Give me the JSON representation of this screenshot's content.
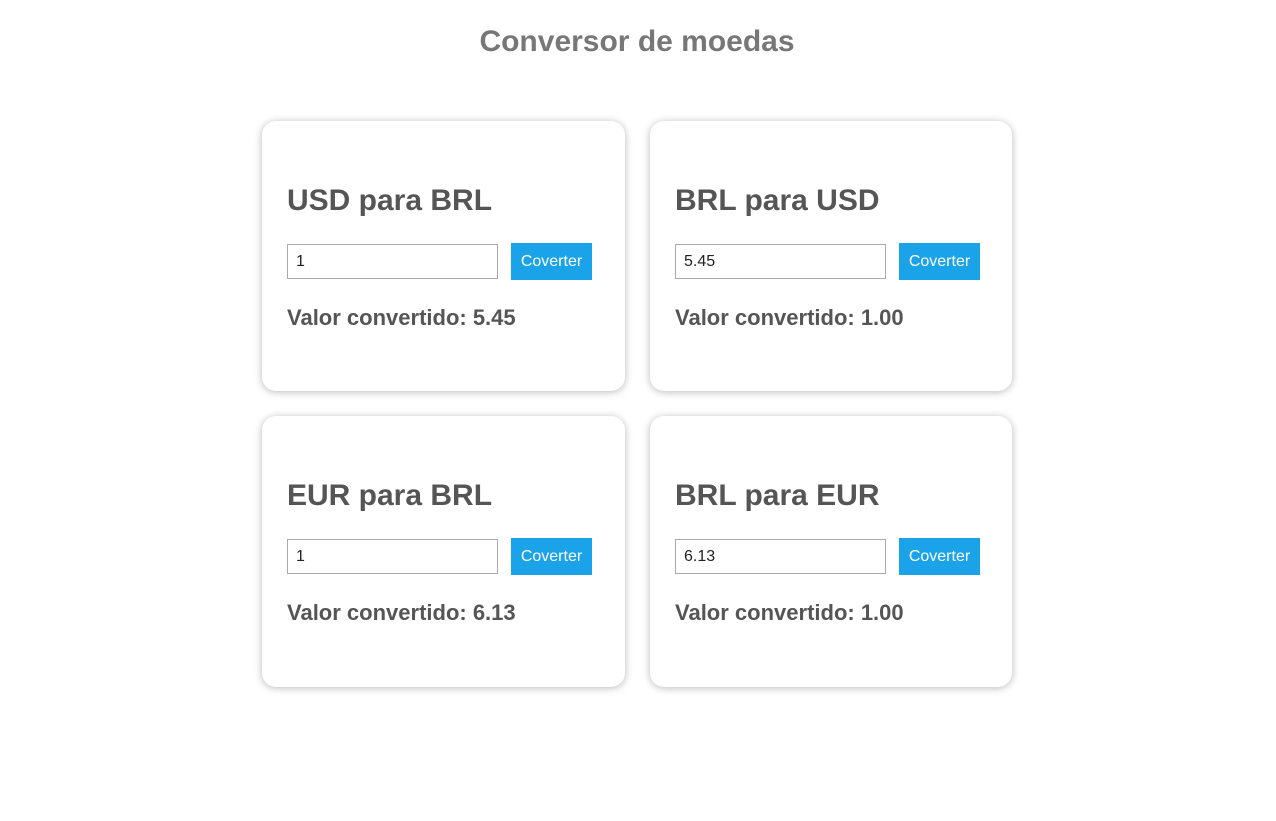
{
  "page": {
    "title": "Conversor de moedas"
  },
  "colors": {
    "button": "#1aa3e8",
    "heading": "#555555",
    "page_title": "#777777"
  },
  "converters": [
    {
      "title": "USD para BRL",
      "input_value": "1",
      "button_label": "Coverter",
      "result_text": "Valor convertido: 5.45"
    },
    {
      "title": "BRL para USD",
      "input_value": "5.45",
      "button_label": "Coverter",
      "result_text": "Valor convertido: 1.00"
    },
    {
      "title": "EUR para BRL",
      "input_value": "1",
      "button_label": "Coverter",
      "result_text": "Valor convertido: 6.13"
    },
    {
      "title": "BRL para EUR",
      "input_value": "6.13",
      "button_label": "Coverter",
      "result_text": "Valor convertido: 1.00"
    }
  ]
}
